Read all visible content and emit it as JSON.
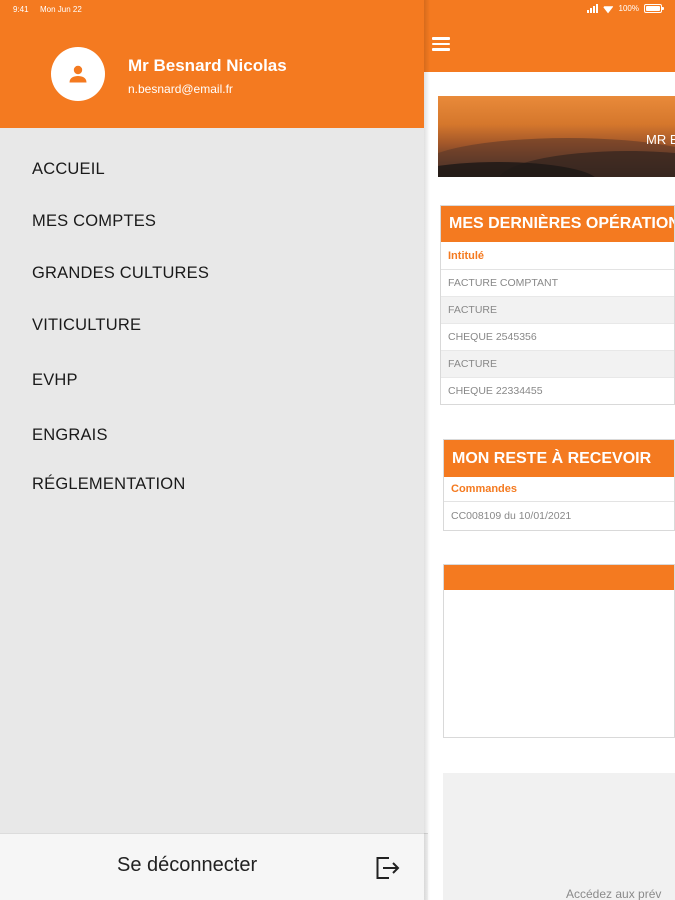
{
  "status_bar": {
    "time": "9:41",
    "date": "Mon Jun 22",
    "battery": "100%"
  },
  "user": {
    "name": "Mr Besnard Nicolas",
    "email": "n.besnard@email.fr"
  },
  "menu": [
    {
      "label": "ACCUEIL"
    },
    {
      "label": "MES COMPTES"
    },
    {
      "label": "GRANDES CULTURES"
    },
    {
      "label": "VITICULTURE"
    },
    {
      "label": "EVHP"
    },
    {
      "label": "ENGRAIS"
    },
    {
      "label": "RÉGLEMENTATION"
    }
  ],
  "footer": {
    "logout_label": "Se déconnecter"
  },
  "banner": {
    "text": "MR B"
  },
  "operations": {
    "title": "MES DERNIÈRES OPÉRATION",
    "column": "Intitulé",
    "rows": [
      "FACTURE COMPTANT",
      "FACTURE",
      "CHEQUE 2545356",
      "FACTURE",
      "CHEQUE 22334455"
    ]
  },
  "reste": {
    "title": "MON RESTE À RECEVOIR",
    "column": "Commandes",
    "rows": [
      "CC008109 du 10/01/2021"
    ]
  },
  "bottom_text": "Accédez aux prév",
  "colors": {
    "accent": "#f47a20",
    "drawer_bg": "#e8e8e8"
  }
}
